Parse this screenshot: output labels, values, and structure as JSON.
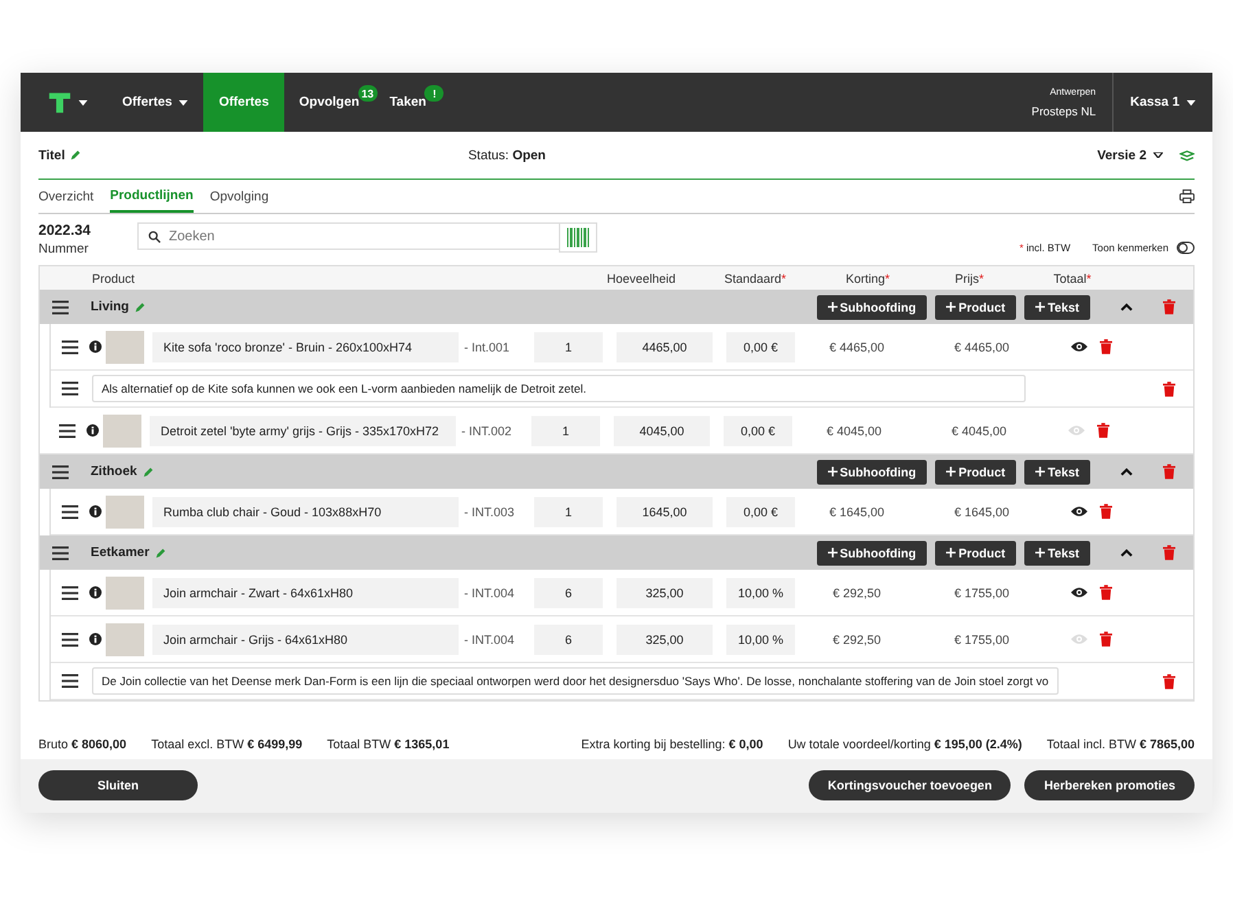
{
  "topbar": {
    "menus": [
      {
        "label": "Offertes",
        "kind": "dropdown",
        "selected": false
      },
      {
        "label": "Offertes",
        "kind": "link",
        "selected": true
      },
      {
        "label": "Opvolgen",
        "kind": "link",
        "selected": false,
        "badge": "13"
      },
      {
        "label": "Taken",
        "kind": "link",
        "selected": false,
        "badge": "!"
      }
    ],
    "location": "Antwerpen",
    "company": "Prosteps NL",
    "register": "Kassa 1"
  },
  "header": {
    "title": "Titel",
    "status_label": "Status:",
    "status": "Open",
    "version": "Versie 2"
  },
  "tabs": [
    {
      "label": "Overzicht",
      "selected": false
    },
    {
      "label": "Productlijnen",
      "selected": true
    },
    {
      "label": "Opvolging",
      "selected": false
    }
  ],
  "number": {
    "value": "2022.34",
    "label": "Nummer"
  },
  "search": {
    "placeholder": "Zoeken"
  },
  "incl_btw": {
    "mark": "*",
    "label": "incl. BTW"
  },
  "toggle": {
    "label": "Toon kenmerken",
    "on": false
  },
  "table": {
    "columns": [
      {
        "label": "Product",
        "required": false
      },
      {
        "label": "Hoeveelheid",
        "required": false
      },
      {
        "label": "Standaard",
        "required": true
      },
      {
        "label": "Korting",
        "required": true
      },
      {
        "label": "Prijs",
        "required": true
      },
      {
        "label": "Totaal",
        "required": true
      }
    ],
    "groups": [
      {
        "name": "Living",
        "add_buttons": [
          "Subhoofding",
          "Product",
          "Tekst"
        ],
        "items": [
          {
            "kind": "block",
            "children": [
              {
                "kind": "product",
                "name": "Kite sofa 'roco bronze' - Bruin - 260x100xH74",
                "code": "- Int.001",
                "quantity": "1",
                "standard": "4465,00",
                "discount": "0,00 €",
                "price": "€ 4465,00",
                "total": "€ 4465,00",
                "visible": true
              },
              {
                "kind": "text",
                "text": "Als alternatief op de Kite sofa kunnen we ook een L-vorm aanbieden namelijk de Detroit zetel."
              }
            ]
          },
          {
            "kind": "product",
            "name": "Detroit zetel 'byte army' grijs - Grijs - 335x170xH72",
            "code": "- INT.002",
            "quantity": "1",
            "standard": "4045,00",
            "discount": "0,00 €",
            "price": "€ 4045,00",
            "total": "€ 4045,00",
            "visible": false
          }
        ]
      },
      {
        "name": "Zithoek",
        "add_buttons": [
          "Subhoofding",
          "Product",
          "Tekst"
        ],
        "items": [
          {
            "kind": "block",
            "children": [
              {
                "kind": "product",
                "name": "Rumba club chair - Goud - 103x88xH70",
                "code": "- INT.003",
                "quantity": "1",
                "standard": "1645,00",
                "discount": "0,00 €",
                "price": "€ 1645,00",
                "total": "€ 1645,00",
                "visible": true
              }
            ]
          }
        ]
      },
      {
        "name": "Eetkamer",
        "add_buttons": [
          "Subhoofding",
          "Product",
          "Tekst"
        ],
        "items": [
          {
            "kind": "block",
            "children": [
              {
                "kind": "product",
                "name": "Join armchair - Zwart - 64x61xH80",
                "code": "- INT.004",
                "quantity": "6",
                "standard": "325,00",
                "discount": "10,00 %",
                "price": "€ 292,50",
                "total": "€ 1755,00",
                "visible": true
              },
              {
                "kind": "product",
                "name": "Join armchair - Grijs - 64x61xH80",
                "code": "- INT.004",
                "quantity": "6",
                "standard": "325,00",
                "discount": "10,00 %",
                "price": "€ 292,50",
                "total": "€ 1755,00",
                "visible": false
              },
              {
                "kind": "text",
                "text": "De Join collectie van het Deense merk Dan-Form is een lijn die speciaal ontworpen werd door het designersduo 'Says Who'. De losse, nonchalante stoffering van de Join stoel zorgt vo"
              }
            ]
          }
        ]
      }
    ]
  },
  "totals": [
    {
      "label": "Bruto",
      "value": "€ 8060,00"
    },
    {
      "label": "Totaal excl. BTW",
      "value": "€ 6499,99"
    },
    {
      "label": "Totaal BTW",
      "value": "€ 1365,01"
    },
    {
      "label": "Extra korting bij bestelling:",
      "value": "€ 0,00"
    },
    {
      "label": "Uw totale voordeel/korting",
      "value": "€ 195,00 (2.4%)"
    },
    {
      "label": "Totaal incl. BTW",
      "value": "€ 7865,00"
    }
  ],
  "footer_buttons": {
    "left": "Sluiten",
    "right": [
      "Kortingsvoucher toevoegen",
      "Herbereken promoties"
    ]
  }
}
